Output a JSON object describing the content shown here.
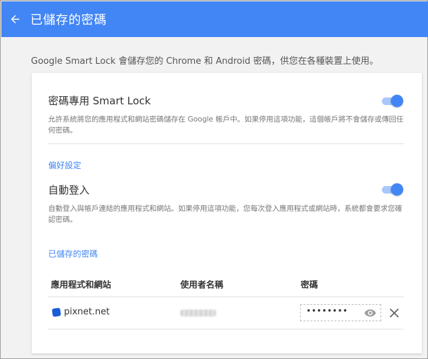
{
  "header": {
    "title": "已儲存的密碼"
  },
  "intro": "Google Smart Lock 會儲存您的 Chrome 和 Android 密碼，供您在各種裝置上使用。",
  "smart_lock": {
    "title": "密碼專用 Smart Lock",
    "description": "允許系統將您的應用程式和網站密碼儲存在 Google 帳戶中。如果停用這項功能，這個帳戶將不會儲存或傳回任何密碼。",
    "enabled": true
  },
  "preferences": {
    "label": "偏好設定",
    "auto_signin": {
      "title": "自動登入",
      "description": "自動登入與帳戶連結的應用程式和網站。如果停用這項功能，您每次登入應用程式或網站時，系統都會要求您確認密碼。",
      "enabled": true
    }
  },
  "saved_passwords": {
    "label": "已儲存的密碼",
    "columns": [
      "應用程式和網站",
      "使用者名稱",
      "密碼"
    ],
    "rows": [
      {
        "site": "pixnet.net",
        "password_mask": "••••••••"
      }
    ]
  },
  "colors": {
    "accent": "#4285f4",
    "toggle_track": "#a8c7fa"
  },
  "icons": {
    "back": "arrow-left-icon",
    "reveal": "eye-icon",
    "delete": "close-icon",
    "site": "pixnet-favicon-icon"
  }
}
